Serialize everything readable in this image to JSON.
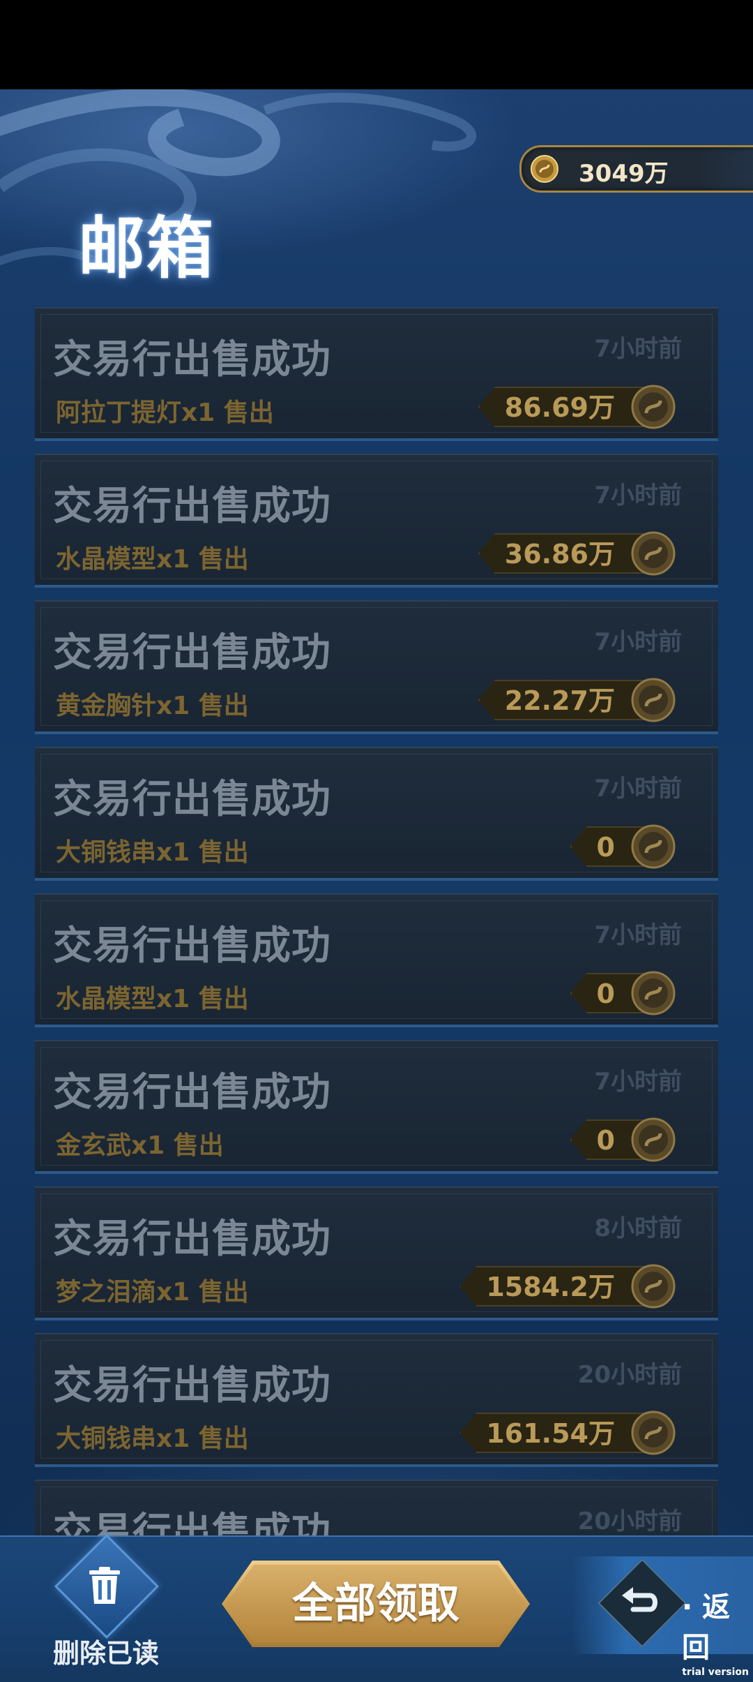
{
  "header": {
    "title": "邮箱",
    "currency_amount": "3049万"
  },
  "mail_items": [
    {
      "subject": "交易行出售成功",
      "time": "7小时前",
      "description": "阿拉丁提灯x1 售出",
      "reward": "86.69万"
    },
    {
      "subject": "交易行出售成功",
      "time": "7小时前",
      "description": "水晶模型x1 售出",
      "reward": "36.86万"
    },
    {
      "subject": "交易行出售成功",
      "time": "7小时前",
      "description": "黄金胸针x1 售出",
      "reward": "22.27万"
    },
    {
      "subject": "交易行出售成功",
      "time": "7小时前",
      "description": "大铜钱串x1 售出",
      "reward": "0"
    },
    {
      "subject": "交易行出售成功",
      "time": "7小时前",
      "description": "水晶模型x1 售出",
      "reward": "0"
    },
    {
      "subject": "交易行出售成功",
      "time": "7小时前",
      "description": "金玄武x1 售出",
      "reward": "0"
    },
    {
      "subject": "交易行出售成功",
      "time": "8小时前",
      "description": "梦之泪滴x1 售出",
      "reward": "1584.2万"
    },
    {
      "subject": "交易行出售成功",
      "time": "20小时前",
      "description": "大铜钱串x1 售出",
      "reward": "161.54万"
    },
    {
      "subject": "交易行出售成功",
      "time": "20小时前",
      "description": "",
      "reward": ""
    }
  ],
  "footer": {
    "delete_label": "删除已读",
    "claim_all_label": "全部领取",
    "back_label": "· 返回",
    "trial_text": "trial version"
  },
  "icons": {
    "currency": "coin-icon",
    "delete": "trash-icon",
    "back": "return-arrow-icon"
  },
  "colors": {
    "accent_gold": "#c89a4a",
    "card_bg": "#1f2d3c",
    "screen_blue": "#153a67"
  }
}
